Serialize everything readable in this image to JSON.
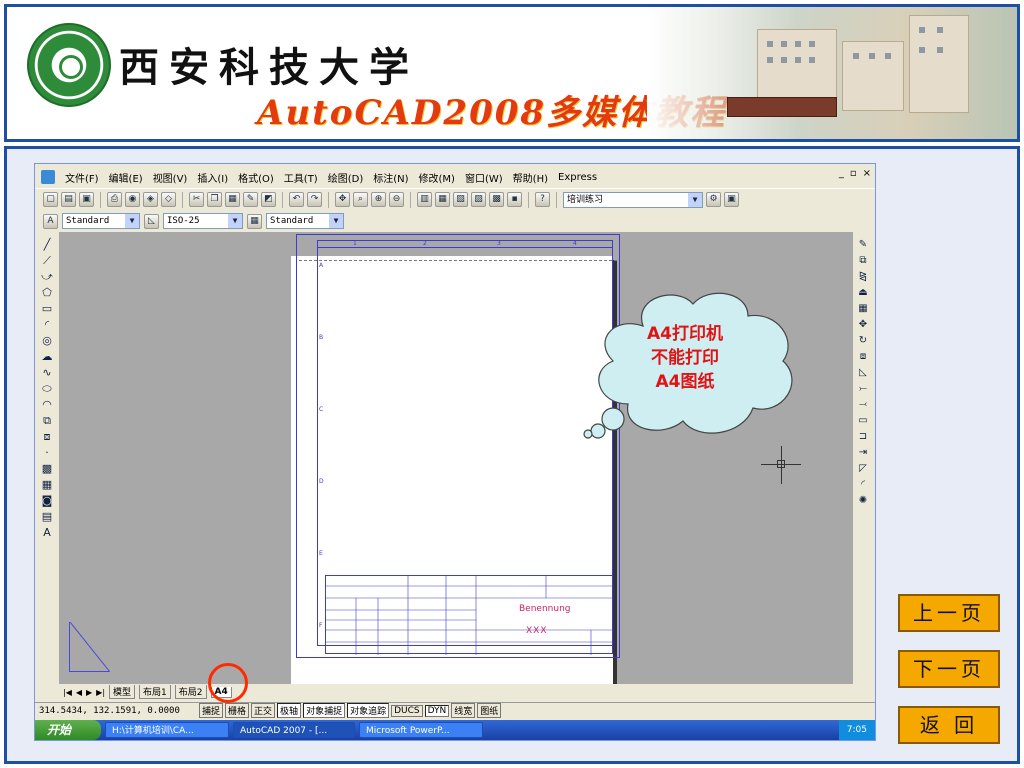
{
  "header": {
    "university": "西安科技大学",
    "course_title": "AutoCAD2008多媒体教程"
  },
  "acad": {
    "menu": [
      "文件(F)",
      "编辑(E)",
      "视图(V)",
      "插入(I)",
      "格式(O)",
      "工具(T)",
      "绘图(D)",
      "标注(N)",
      "修改(M)",
      "窗口(W)",
      "帮助(H)",
      "Express"
    ],
    "workspace": "培训练习",
    "text_style": "Standard",
    "dim_style": "ISO-25",
    "table_style": "Standard",
    "zone_numbers": [
      "1",
      "2",
      "3",
      "4"
    ],
    "zone_letters": [
      "A",
      "B",
      "C",
      "D",
      "E",
      "F"
    ],
    "title_block": {
      "benennung": "Benennung",
      "xxx": "XXX"
    },
    "layout_tabs": [
      "模型",
      "布局1",
      "布局2",
      "A4"
    ],
    "active_tab": "A4",
    "status": {
      "coords": "314.5434, 132.1591, 0.0000",
      "buttons": [
        "捕捉",
        "栅格",
        "正交",
        "极轴",
        "对象捕捉",
        "对象追踪",
        "DUCS",
        "DYN",
        "线宽",
        "图纸"
      ]
    },
    "taskbar": {
      "start": "开始",
      "tasks": [
        "H:\\计算机培训\\CA...",
        "AutoCAD 2007 - [...",
        "Microsoft PowerP..."
      ],
      "clock": "7:05"
    }
  },
  "bubble": {
    "line1": "A4打印机",
    "line2": "不能打印",
    "line3": "A4图纸"
  },
  "nav": {
    "prev": "上一页",
    "next": "下一页",
    "back": "返 回"
  },
  "colors": {
    "frame": "#1f4fa3",
    "accent_title": "#e33a10",
    "nav_button": "#f5a900",
    "bubble_text": "#e01414",
    "highlight_circle": "#ff2a00"
  }
}
